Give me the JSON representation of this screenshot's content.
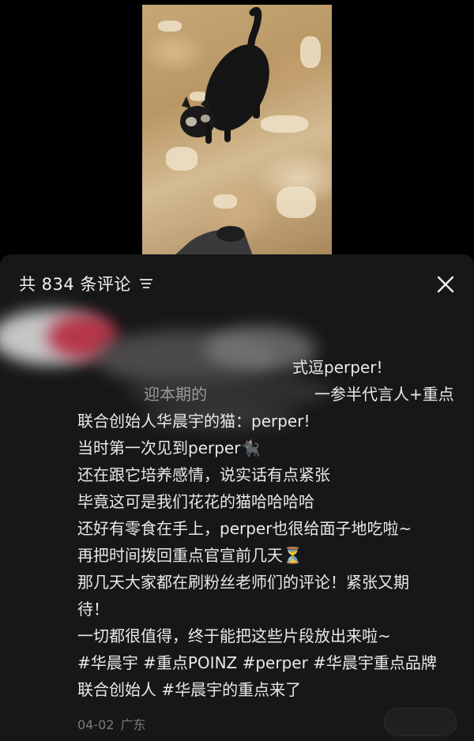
{
  "header": {
    "title": "共 834 条评论",
    "sort_icon": "filter-lines-icon",
    "close_icon": "close-icon"
  },
  "comment": {
    "partial_line_1": "式逗perper!",
    "partial_line_2_left": "迎本期的",
    "partial_line_2_right": "一参半代言人+重点",
    "lines": [
      "联合创始人华晨宇的猫：perper!",
      "当时第一次见到perper🐈‍⬛",
      "还在跟它培养感情，说实话有点紧张",
      "毕竟这可是我们花花的猫哈哈哈哈",
      "还好有零食在手上，perper也很给面子地吃啦~",
      "再把时间拨回重点官宣前几天⏳",
      "那几天大家都在刷粉丝老师们的评论！紧张又期",
      "待！",
      "一切都很值得，终于能把这些片段放出来啦~",
      "#华晨宇 #重点POINZ #perper #华晨宇重点品牌",
      "联合创始人 #华晨宇的重点来了"
    ],
    "date": "04-02",
    "region": "广东"
  },
  "colors": {
    "panel_bg": "#161718",
    "text": "#e9e9e9",
    "meta": "#7c7c7c"
  }
}
